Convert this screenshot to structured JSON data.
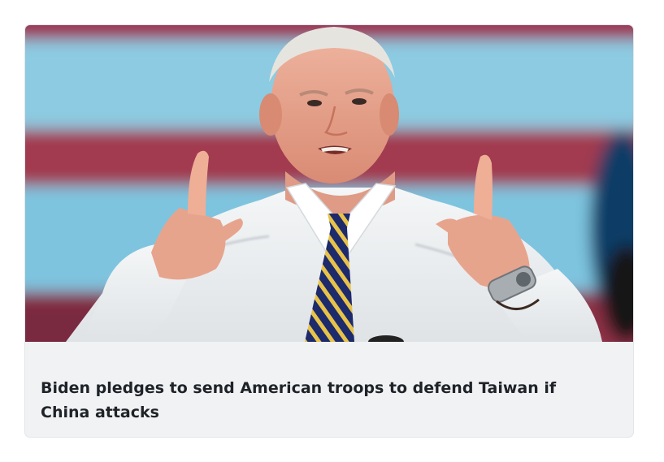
{
  "article": {
    "headline": "Biden pledges to send American troops to defend Taiwan if China attacks"
  },
  "colors": {
    "caption_background": "#f0f2f4",
    "headline_text": "#1f2328",
    "card_border": "#e3e5e8"
  }
}
